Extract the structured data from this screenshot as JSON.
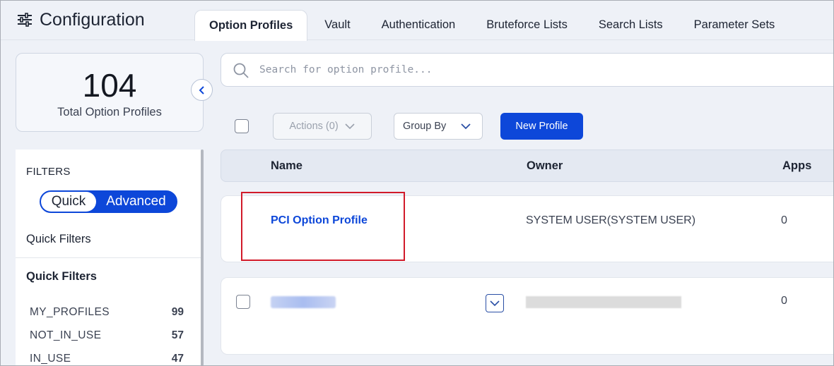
{
  "header": {
    "title": "Configuration",
    "tabs": [
      {
        "label": "Option Profiles",
        "active": true
      },
      {
        "label": "Vault"
      },
      {
        "label": "Authentication"
      },
      {
        "label": "Bruteforce Lists"
      },
      {
        "label": "Search Lists"
      },
      {
        "label": "Parameter Sets"
      }
    ]
  },
  "summary": {
    "count": "104",
    "label": "Total Option Profiles"
  },
  "filters": {
    "title": "FILTERS",
    "toggle": {
      "quick": "Quick",
      "advanced": "Advanced",
      "selected": "Quick"
    },
    "quick_filters_heading": "Quick Filters",
    "quick_filters_subheading": "Quick Filters",
    "items": [
      {
        "name": "MY_PROFILES",
        "count": "99"
      },
      {
        "name": "NOT_IN_USE",
        "count": "57"
      },
      {
        "name": "IN_USE",
        "count": "47"
      }
    ]
  },
  "search": {
    "placeholder": "Search for option profile...",
    "value": ""
  },
  "toolbar": {
    "actions_label": "Actions (0)",
    "group_by_label": "Group By",
    "new_profile_label": "New Profile"
  },
  "table": {
    "columns": [
      "Name",
      "Owner",
      "Apps"
    ],
    "rows": [
      {
        "name": "PCI Option Profile",
        "owner": "SYSTEM USER(SYSTEM USER)",
        "apps": "0",
        "highlighted": true
      },
      {
        "name": "",
        "owner": "",
        "apps": "0",
        "redacted": true
      }
    ]
  },
  "colors": {
    "accent": "#0d47d9",
    "highlight": "#d11a2a",
    "background": "#eef1f7"
  }
}
